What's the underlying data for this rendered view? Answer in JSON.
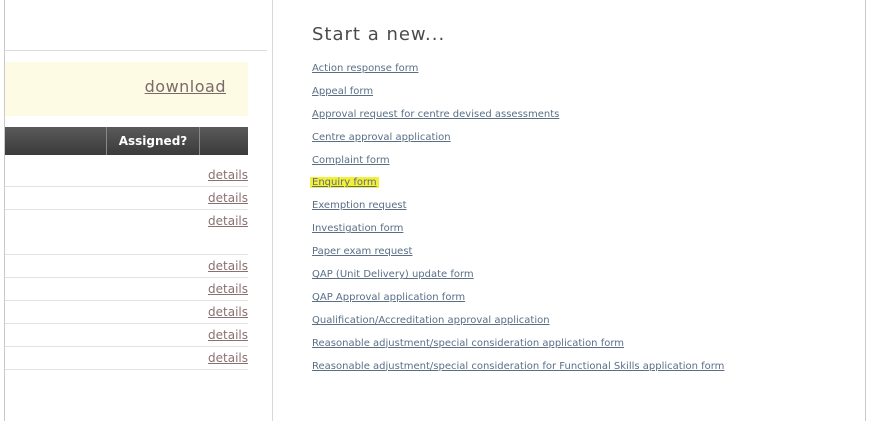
{
  "left": {
    "download_label": "download",
    "header": {
      "assigned": "Assigned?"
    },
    "rows": [
      {
        "action": "details"
      },
      {
        "action": "details"
      },
      {
        "action": "details"
      },
      {
        "action": "details"
      },
      {
        "action": "details"
      },
      {
        "action": "details"
      },
      {
        "action": "details"
      },
      {
        "action": "details"
      }
    ]
  },
  "right": {
    "title": "Start a new...",
    "links": [
      "Action response form",
      "Appeal form",
      "Approval request for centre devised assessments",
      "Centre approval application",
      "Complaint form",
      "Enquiry form",
      "Exemption request",
      "Investigation form",
      "Paper exam request",
      "QAP (Unit Delivery) update form",
      "QAP Approval application form",
      "Qualification/Accreditation approval application",
      "Reasonable adjustment/special consideration application form",
      "Reasonable adjustment/special consideration for Functional Skills application form"
    ],
    "highlighted_link": "Enquiry form",
    "highlight_color": "#f5ef3a"
  }
}
